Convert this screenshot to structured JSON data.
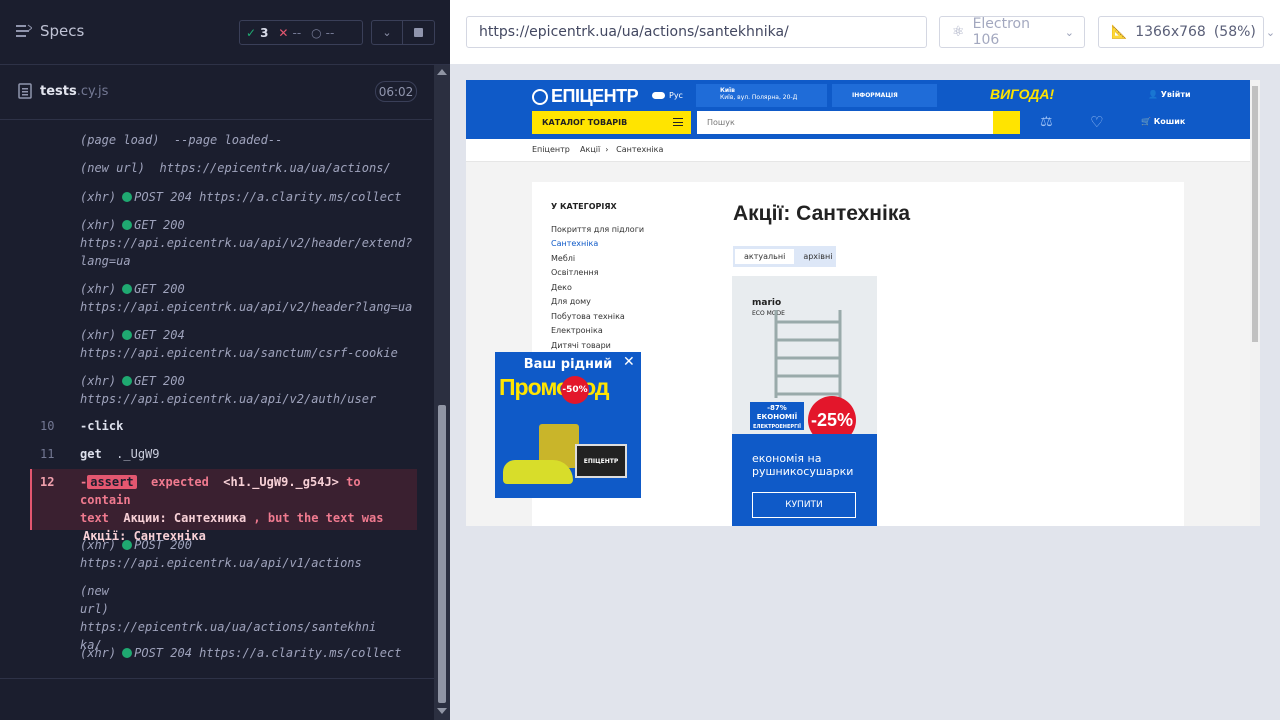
{
  "runner": {
    "specs_label": "Specs",
    "stats": {
      "passed": "3",
      "failed": "--",
      "pending": "--"
    },
    "file": {
      "name": "tests",
      "ext": ".cy.js",
      "duration": "06:02"
    },
    "log": [
      {
        "label": "(page load)",
        "text": "--page loaded--"
      },
      {
        "label": "(new url)",
        "text": "https://epicentrk.ua/ua/actions/"
      },
      {
        "label": "(xhr)",
        "text": "POST 204 https://a.clarity.ms/collect"
      },
      {
        "label": "(xhr)",
        "text": "GET 200",
        "text2": "https://api.epicentrk.ua/api/v2/header/extend?",
        "text3": "lang=ua"
      },
      {
        "label": "(xhr)",
        "text": "GET 200",
        "text2": "https://api.epicentrk.ua/api/v2/header?lang=ua"
      },
      {
        "label": "(xhr)",
        "text": "GET 204",
        "text2": "https://api.epicentrk.ua/sanctum/csrf-cookie"
      },
      {
        "label": "(xhr)",
        "text": "GET 200",
        "text2": "https://api.epicentrk.ua/api/v2/auth/user"
      },
      {
        "num": "10",
        "cmd": "-click"
      },
      {
        "num": "11",
        "cmd": "get",
        "arg": "._UgW9"
      },
      {
        "num": "12",
        "badge": "assert",
        "t1": "expected",
        "t2": "<h1._UgW9._g54J>",
        "t3": "to contain",
        "t4": "text",
        "t5": "Акции: Сантехника",
        "t6": ", but the text was",
        "t7": "Акції: Сантехніка"
      },
      {
        "label": "(xhr)",
        "text": "POST 200",
        "text2": "https://api.epicentrk.ua/api/v1/actions"
      },
      {
        "label": "(new",
        "label2": "url)",
        "text": "https://epicentrk.ua/ua/actions/santekhni",
        "text2": "ka/"
      },
      {
        "label": "(xhr)",
        "text": "POST 204 https://a.clarity.ms/collect"
      }
    ]
  },
  "preview": {
    "url": "https://epicentrk.ua/ua/actions/santekhnika/",
    "browser": "Electron 106",
    "viewport": "1366x768",
    "scale": "(58%)"
  },
  "site": {
    "logo": "ЕПІЦЕНТР",
    "lang": "Рус",
    "city": "Київ",
    "address": "Київ, вул. Полярна, 20-Д",
    "info": "ІНФОРМАЦІЯ",
    "vyhoda": "ВИГОДА!",
    "login": "Увійти",
    "catalog": "КАТАЛОГ ТОВАРІВ",
    "search_placeholder": "Пошук",
    "cart": "Кошик",
    "breadcrumbs": [
      "Епіцентр",
      "Акції",
      "Сантехніка"
    ],
    "categories_title": "У КАТЕГОРІЯХ",
    "categories": [
      "Покриття для підлоги",
      "Сантехніка",
      "Меблі",
      "Освітлення",
      "Деко",
      "Для дому",
      "Побутова техніка",
      "Електроніка",
      "Дитячі товари"
    ],
    "active_category": 1,
    "title": "Акції: Сантехніка",
    "tabs": [
      "актуальні",
      "архівні"
    ],
    "promo": {
      "brand": "mario",
      "brand2": "ECO MODE",
      "eco_pct": "-87%",
      "eco_label": "ЕКОНОМІЇ",
      "eco_label2": "ЕЛЕКТРОЕНЕРГІЇ",
      "discount": "-25%",
      "caption": "економія на рушникосушарки",
      "buy": "КУПИТИ"
    },
    "popup": {
      "title": "Ваш рідний",
      "promo": "ПромоКод",
      "pct": "-50%",
      "laptop": "ЕПІЦЕНТР"
    }
  },
  "colors": {
    "pass": "#1fa971",
    "fail": "#e45770",
    "brand_blue": "#0f5ac8",
    "brand_yellow": "#ffe400"
  }
}
